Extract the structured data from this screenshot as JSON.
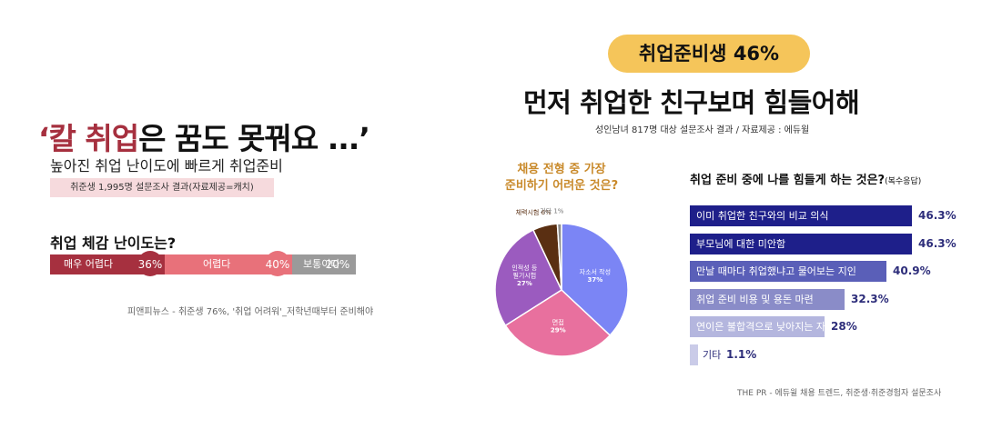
{
  "left": {
    "title_accent": "‘칼 취업",
    "title_rest": "은 꿈도 못꿔요 ...’",
    "subtitle": "높아진 취업 난이도에 빠르게 취업준비",
    "survey_note": "취준생 1,995명 설문조사 결과(자료제공=캐치)",
    "question": "취업 체감 난이도는?",
    "source": "피앤피뉴스 - 취준생 76%, '취업 어려워'_저학년때부터 준비해야"
  },
  "right": {
    "badge": "취업준비생 46%",
    "headline": "먼저 취업한 친구보며 힘들어해",
    "subtitle": "성인남녀 817명 대상 설문조사 결과 / 자료제공 : 에듀윌",
    "pie_question_line1": "채용 전형 중 가장",
    "pie_question_line2": "준비하기 어려운 것은?",
    "bar_question": "취업 준비 중에 나를 힘들게 하는 것은?",
    "bar_question_note": "(복수응답)",
    "source": "THE PR - 에듀윌 채용 트렌드, 취준생·취준경험자 설문조사"
  },
  "chart_data": [
    {
      "type": "bar",
      "orientation": "horizontal-stacked",
      "title": "취업 체감 난이도는?",
      "categories": [
        "매우 어렵다",
        "어렵다",
        "보통이다"
      ],
      "values": [
        36,
        40,
        20
      ],
      "value_labels": [
        "36%",
        "40%",
        "20%"
      ],
      "colors": [
        "#a6303f",
        "#e8717a",
        "#9a9a9a"
      ]
    },
    {
      "type": "pie",
      "title": "채용 전형 중 가장 준비하기 어려운 것은?",
      "categories": [
        "자소서 작성",
        "면접",
        "인적성 등 필기시험",
        "체력시험",
        "기타"
      ],
      "label_lines": [
        [
          "자소서 작성",
          "37%"
        ],
        [
          "면접",
          "29%"
        ],
        [
          "인적성 등",
          "필기시험",
          "27%"
        ],
        [
          "체력시험 6%"
        ],
        [
          "기타 1%"
        ]
      ],
      "values": [
        37,
        29,
        27,
        6,
        1
      ],
      "colors": [
        "#7b85f5",
        "#e8709e",
        "#9b5bbf",
        "#5a2f12",
        "#8a8a8a"
      ]
    },
    {
      "type": "bar",
      "orientation": "horizontal",
      "title": "취업 준비 중에 나를 힘들게 하는 것은?(복수응답)",
      "categories": [
        "이미 취업한 친구와의 비교 의식",
        "부모님에 대한 미안함",
        "만날 때마다 취업했냐고 물어보는 지인",
        "취업 준비 비용 및 용돈 마련",
        "연이은 불합격으로 낮아지는 자신감",
        "기타"
      ],
      "values": [
        46.3,
        46.3,
        40.9,
        32.3,
        28,
        1.1
      ],
      "value_labels": [
        "46.3%",
        "46.3%",
        "40.9%",
        "32.3%",
        "28%",
        "1.1%"
      ],
      "colors": [
        "#1e1f8a",
        "#1e1f8a",
        "#5a5fb8",
        "#8a8cc8",
        "#b4b6de",
        "#cacbe8"
      ],
      "xlim": [
        0,
        46.3
      ]
    }
  ]
}
